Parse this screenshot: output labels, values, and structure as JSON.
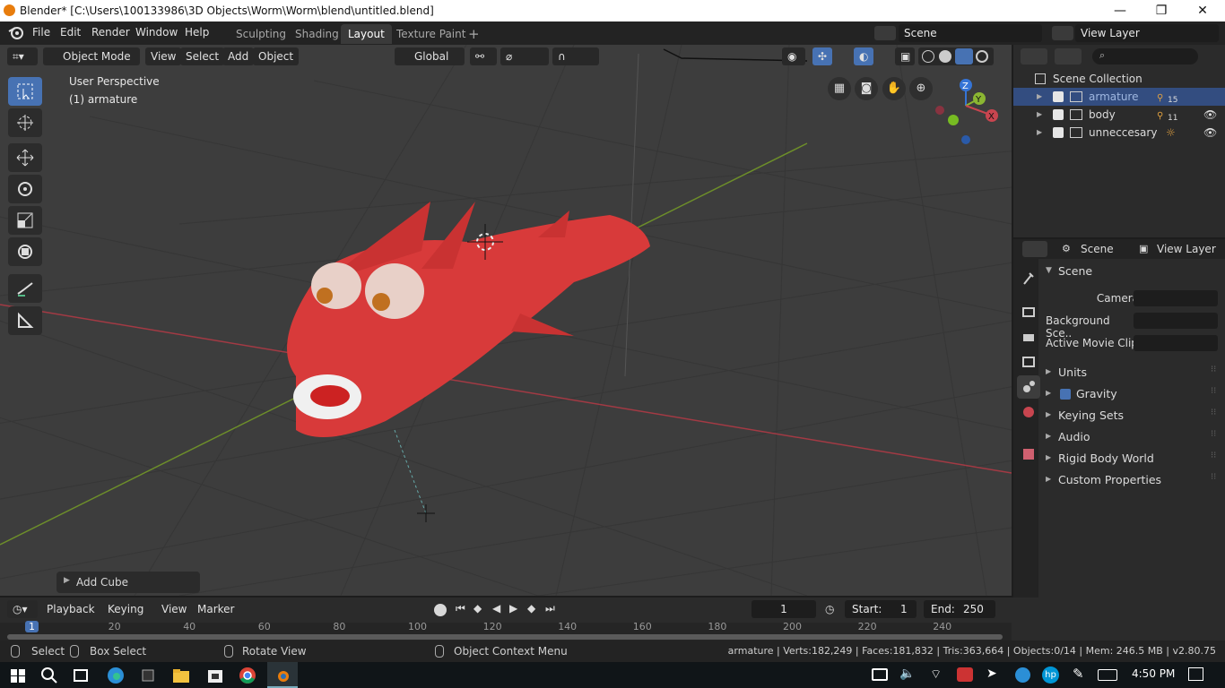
{
  "window": {
    "title": "Blender* [C:\\Users\\100133986\\3D Objects\\Worm\\Worm\\blend\\untitled.blend]",
    "minimize": "—",
    "maximize": "❐",
    "close": "✕"
  },
  "menu": {
    "items": [
      "File",
      "Edit",
      "Render",
      "Window",
      "Help"
    ],
    "workspaces": [
      "Sculpting",
      "Shading",
      "Layout",
      "Texture Paint"
    ],
    "active_workspace": "Layout",
    "add_workspace": "+",
    "scene": "Scene",
    "view_layer": "View Layer"
  },
  "viewport_header": {
    "mode": "Object Mode",
    "menus": [
      "View",
      "Select",
      "Add",
      "Object"
    ],
    "orientation": "Global"
  },
  "viewport": {
    "perspective": "User Perspective",
    "active_object": "(1) armature",
    "last_operator": "Add Cube",
    "gizmo": {
      "z": "Z",
      "y": "Y",
      "x": "X"
    }
  },
  "outliner": {
    "root": "Scene Collection",
    "items": [
      {
        "name": "armature",
        "badge": "15",
        "selected": true
      },
      {
        "name": "body",
        "badge": "11",
        "selected": false
      },
      {
        "name": "unneccesary",
        "badge": "",
        "selected": false
      }
    ]
  },
  "properties": {
    "header_scene": "Scene",
    "header_view_layer": "View Layer",
    "panel": "Scene",
    "fields": [
      {
        "label": "Camera"
      },
      {
        "label": "Background Sce.."
      },
      {
        "label": "Active Movie Clip"
      }
    ],
    "subpanels": [
      "Units",
      "Gravity",
      "Keying Sets",
      "Audio",
      "Rigid Body World",
      "Custom Properties"
    ],
    "gravity_checked": true
  },
  "timeline": {
    "menus": [
      "Playback",
      "Keying",
      "View",
      "Marker"
    ],
    "current_frame": "1",
    "start_label": "Start:",
    "start": "1",
    "end_label": "End:",
    "end": "250",
    "ruler": [
      "1",
      "20",
      "40",
      "60",
      "80",
      "100",
      "120",
      "140",
      "160",
      "180",
      "200",
      "220",
      "240"
    ]
  },
  "statusbar": {
    "select": "Select",
    "box_select": "Box Select",
    "rotate_view": "Rotate View",
    "context_menu": "Object Context Menu",
    "stats": "armature | Verts:182,249 | Faces:181,832 | Tris:363,664 | Objects:0/14 | Mem: 246.5 MB | v2.80.75"
  },
  "taskbar": {
    "time": "4:50 PM"
  },
  "colors": {
    "accent": "#4772b3",
    "viewport_bg": "#3d3d3d",
    "model": "#d83a3a",
    "x_axis": "#c8454f",
    "y_axis": "#8bb632",
    "z_axis": "#3574d6"
  }
}
